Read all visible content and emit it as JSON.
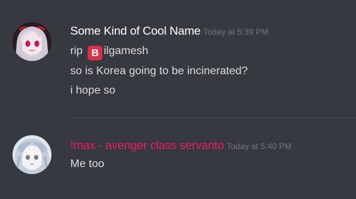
{
  "messages": [
    {
      "username": "Some Kind of Cool Name",
      "username_color": "#ffffff",
      "timestamp": "Today at 5:39 PM",
      "avatar_icon": "anime-avatar-icon",
      "lines": [
        {
          "prefix": "rip ",
          "emoji": "B",
          "emoji_icon": "b-button-emoji-icon",
          "suffix": "ilgamesh"
        },
        {
          "text": "so is Korea going to be incinerated?"
        },
        {
          "text": "i hope so"
        }
      ]
    },
    {
      "username": "!max - avenger class servanto",
      "username_color": "#e91e63",
      "timestamp": "Today at 5:40 PM",
      "avatar_icon": "anime-avatar-icon",
      "lines": [
        {
          "text": "Me too"
        }
      ]
    }
  ]
}
